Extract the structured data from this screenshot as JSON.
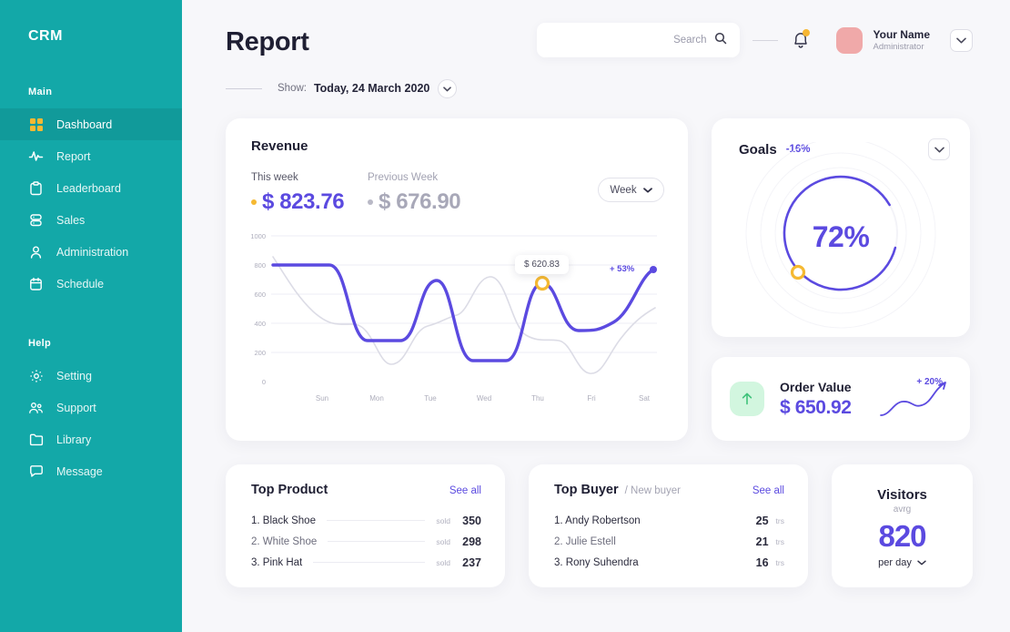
{
  "sidebar": {
    "brand": "CRM",
    "sections": [
      {
        "title": "Main",
        "items": [
          {
            "label": "Dashboard",
            "icon": "grid-icon",
            "active": true
          },
          {
            "label": "Report",
            "icon": "activity-icon",
            "active": false
          },
          {
            "label": "Leaderboard",
            "icon": "clipboard-icon",
            "active": false
          },
          {
            "label": "Sales",
            "icon": "database-icon",
            "active": false
          },
          {
            "label": "Administration",
            "icon": "user-icon",
            "active": false
          },
          {
            "label": "Schedule",
            "icon": "calendar-icon",
            "active": false
          }
        ]
      },
      {
        "title": "Help",
        "items": [
          {
            "label": "Setting",
            "icon": "gear-icon",
            "active": false
          },
          {
            "label": "Support",
            "icon": "users-icon",
            "active": false
          },
          {
            "label": "Library",
            "icon": "folder-icon",
            "active": false
          },
          {
            "label": "Message",
            "icon": "message-icon",
            "active": false
          }
        ]
      }
    ]
  },
  "header": {
    "page_title": "Report",
    "search_placeholder": "Search",
    "search_value": "",
    "search_icon": "magnifier-icon",
    "bell_icon": "bell-icon",
    "avatar": "user-avatar",
    "user_name": "Your Name",
    "user_role": "Administrator",
    "account_chevron": "chevron-down-icon"
  },
  "showbar": {
    "label": "Show:",
    "value": "Today, 24 March 2020",
    "chevron": "chevron-down-icon"
  },
  "revenue": {
    "title": "Revenue",
    "this_week_label": "This week",
    "this_week_value": "$ 823.76",
    "prev_week_label": "Previous Week",
    "prev_week_value": "$ 676.90",
    "range_button": "Week",
    "range_chevron": "chevron-down-icon",
    "tooltip_value": "$ 620.83",
    "growth_tag": "+ 53%"
  },
  "goals": {
    "title": "Goals",
    "delta": "-16%",
    "percent": "72%",
    "percent_value": 72,
    "chevron": "chevron-down-icon"
  },
  "order_value": {
    "icon": "arrow-up-icon",
    "title": "Order Value",
    "value": "$ 650.92",
    "growth": "+ 20%"
  },
  "top_product": {
    "title": "Top Product",
    "see_all": "See all",
    "unit": "sold",
    "rows": [
      {
        "name": "1. Black Shoe",
        "count": "350"
      },
      {
        "name": "2. White Shoe",
        "count": "298"
      },
      {
        "name": "3. Pink Hat",
        "count": "237"
      }
    ]
  },
  "top_buyer": {
    "title": "Top Buyer",
    "subtitle": "/ New buyer",
    "see_all": "See all",
    "unit": "trs",
    "rows": [
      {
        "name": "1. Andy Robertson",
        "count": "25"
      },
      {
        "name": "2. Julie Estell",
        "count": "21"
      },
      {
        "name": "3. Rony Suhendra",
        "count": "16"
      }
    ]
  },
  "visitors": {
    "title": "Visitors",
    "sub": "avrg",
    "value": "820",
    "footer": "per day",
    "chevron": "chevron-down-icon"
  },
  "colors": {
    "sidebar": "#13a8a8",
    "accent_purple": "#5b4ae0",
    "accent_amber": "#f5b932",
    "accent_green": "#38c172",
    "avatar_pink": "#f0a9a9",
    "page_bg": "#f7f7fa"
  },
  "chart_data": {
    "type": "line",
    "title": "Revenue",
    "xlabel": "",
    "ylabel": "",
    "categories": [
      "Sun",
      "Mon",
      "Tue",
      "Wed",
      "Thu",
      "Fri",
      "Sat"
    ],
    "yticks": [
      0,
      200,
      400,
      600,
      800,
      1000
    ],
    "ylim": [
      0,
      1000
    ],
    "grid": true,
    "legend": [
      "This week",
      "Previous Week"
    ],
    "series": [
      {
        "name": "This week",
        "color": "#5b4ae0",
        "values": [
          800,
          290,
          685,
          210,
          672,
          450,
          775
        ]
      },
      {
        "name": "Previous Week",
        "color": "#d8d8e2",
        "values": [
          855,
          190,
          415,
          700,
          330,
          130,
          490
        ]
      }
    ],
    "annotations": [
      {
        "label": "$ 620.83",
        "x": "Thu",
        "y": 672
      },
      {
        "label": "+ 53%",
        "x": "Sat",
        "y": 775
      }
    ]
  }
}
